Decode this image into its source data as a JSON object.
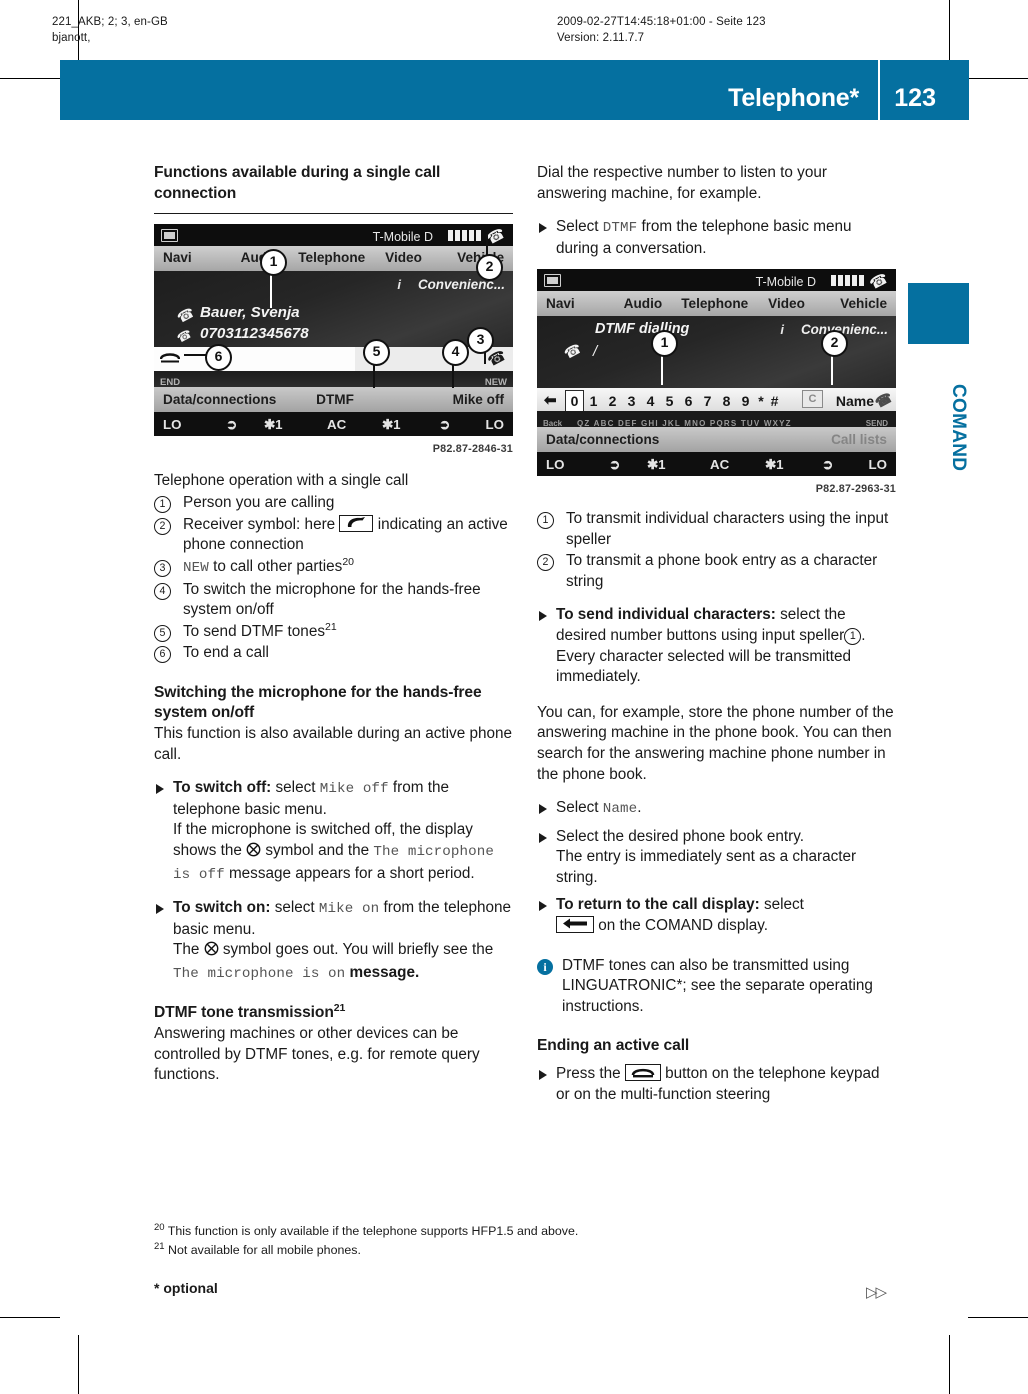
{
  "jobticket": {
    "left": "221_AKB; 2; 3, en-GB\nbjanott,",
    "middle": "2009-02-27T14:45:18+01:00 - Seite 123\nVersion: 2.11.7.7"
  },
  "running_head": {
    "title": "Telephone*",
    "page_number": "123",
    "chapter_tab": "COMAND",
    "accent_color": "#0570a0"
  },
  "left_column": {
    "heading": "Functions available during a single call connection",
    "figure": {
      "status": {
        "sim_icon": "sim-card-icon",
        "carrier": "T-Mobile D",
        "signal_bars": 5,
        "handset_icon": "handset-active-icon"
      },
      "menu": [
        "Navi",
        "Audio",
        "Telephone",
        "Video",
        "Vehicle"
      ],
      "convenience_label": "Convenienc...",
      "call_name": "Bauer, Svenja",
      "call_number": "0703112345678",
      "end_sub_label": "END",
      "new_sub_label": "NEW",
      "soft_left": "Data/connections",
      "soft_mid": "DTMF",
      "soft_right": "Mike off",
      "climate": [
        "LO",
        "fan-icon",
        "1",
        "AC",
        "1",
        "fan-icon",
        "LO"
      ],
      "caption": "P82.87-2846-31",
      "callouts": [
        "1",
        "2",
        "3",
        "4",
        "5",
        "6"
      ]
    },
    "legend_intro": "Telephone operation with a single call",
    "legend": [
      {
        "num": "1",
        "text": "Person you are calling"
      },
      {
        "num": "2",
        "text_before": "Receiver symbol: here",
        "glyph": "handset-boxed-icon",
        "text_after": "indicating an active phone connection"
      },
      {
        "num": "3",
        "screen": "NEW",
        "text_after": "to call other parties",
        "footnote": "20"
      },
      {
        "num": "4",
        "text": "To switch the microphone for the hands-free system on/off"
      },
      {
        "num": "5",
        "text": "To send DTMF tones",
        "footnote": "21"
      },
      {
        "num": "6",
        "text": "To end a call"
      }
    ],
    "section2": {
      "heading": "Switching the microphone for the hands-free system on/off",
      "intro": "This function is also available during an active phone call.",
      "item_off": {
        "bold": "To switch off:",
        "t1": "select",
        "screen1": "Mike off",
        "t2": "from the telephone basic menu.",
        "t3": "If the microphone is switched off, the display shows the",
        "glyph": "mic-off-icon",
        "t4": "symbol and the",
        "screen2": "The microphone is off",
        "t5": "message appears for a short period."
      },
      "item_on": {
        "bold": "To switch on:",
        "t1": "select",
        "screen1": "Mike on",
        "t2": "from the telephone basic menu.",
        "t3": "The",
        "glyph": "mic-off-icon",
        "t4": "symbol goes out. You will briefly see the",
        "screen2": "The microphone is on",
        "t5": "message."
      }
    },
    "section3": {
      "heading": "DTMF tone transmission",
      "heading_footnote": "21",
      "body": "Answering machines or other devices can be controlled by DTMF tones, e.g. for remote query functions."
    }
  },
  "right_column": {
    "intro": "Dial the respective number to listen to your answering machine, for example.",
    "select_item": {
      "t1": "Select",
      "screen": "DTMF",
      "t2": "from the telephone basic menu during a conversation."
    },
    "figure": {
      "status": {
        "sim_icon": "sim-card-icon",
        "carrier": "T-Mobile D",
        "signal_bars": 5,
        "handset_icon": "handset-active-icon"
      },
      "menu": [
        "Navi",
        "Audio",
        "Telephone",
        "Video",
        "Vehicle"
      ],
      "title": "DTMF dialling",
      "convenience_label": "Convenienc...",
      "input_cursor": "/",
      "speller_keys": [
        "0",
        "1",
        "2",
        "3",
        "4",
        "5",
        "6",
        "7",
        "8",
        "9",
        "*",
        "#"
      ],
      "selected_key": "0",
      "clear_key": "C",
      "name_key": "Name",
      "back_label": "Back",
      "letters_row": "QZ ABC DEF GHI JKL MNO PQRS TUV WXYZ",
      "send_label": "SEND",
      "soft_left": "Data/connections",
      "soft_right": "Call lists",
      "climate": [
        "LO",
        "fan-icon",
        "1",
        "AC",
        "1",
        "fan-icon",
        "LO"
      ],
      "caption": "P82.87-2963-31",
      "callouts": [
        "1",
        "2"
      ]
    },
    "legend": [
      {
        "num": "1",
        "text": "To transmit individual characters using the input speller"
      },
      {
        "num": "2",
        "text": "To transmit a phone book entry as a character string"
      }
    ],
    "item_send": {
      "bold": "To send individual characters:",
      "t1": "select the desired number buttons using input speller",
      "ref": "1",
      "t2": ".",
      "t3": "Every character selected will be transmitted immediately."
    },
    "para_store": "You can, for example, store the phone number of the answering machine in the phone book. You can then search for the answering machine phone number in the phone book.",
    "item_name": {
      "t1": "Select",
      "screen": "Name",
      "t2": "."
    },
    "item_entry": {
      "t1": "Select the desired phone book entry.",
      "t2": "The entry is immediately sent as a character string."
    },
    "item_return": {
      "bold": "To return to the call display:",
      "t1": "select",
      "glyph": "left-arrow-boxed-icon",
      "t2": "on the COMAND display."
    },
    "note": {
      "icon": "info-icon",
      "text": "DTMF tones can also be transmitted using LINGUATRONIC*; see the separate operating instructions."
    },
    "section_end": {
      "heading": "Ending an active call",
      "item": {
        "t1": "Press the",
        "glyph": "handset-end-boxed-icon",
        "t2": "button on the telephone keypad or on the multi-function steering"
      }
    }
  },
  "footnotes": [
    {
      "num": "20",
      "text": "This function is only available if the telephone supports HFP1.5 and above."
    },
    {
      "num": "21",
      "text": "Not available for all mobile phones."
    }
  ],
  "optional_note": "* optional",
  "next_page_mark": "▷▷"
}
